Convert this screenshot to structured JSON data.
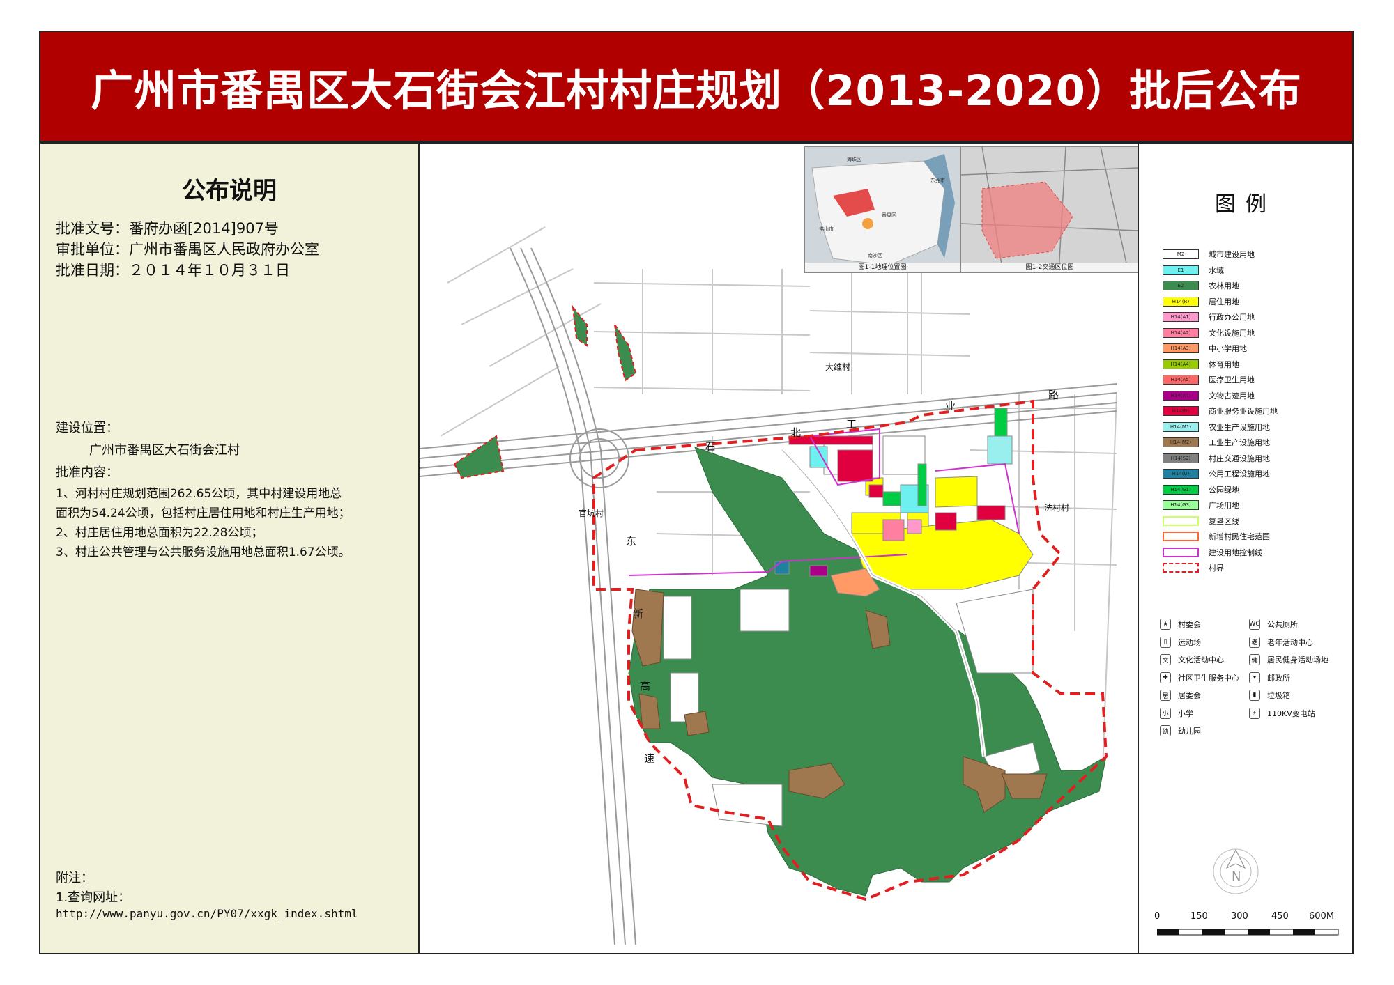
{
  "title": "广州市番禺区大石街会江村村庄规划（2013-2020）批后公布",
  "notice": {
    "heading": "公布说明",
    "approval_no": "批准文号：番府办函[2014]907号",
    "approval_unit": "审批单位：广州市番禺区人民政府办公室",
    "approval_date": "批准日期：２０１４年１０月３１日",
    "location_label": "建设位置：",
    "location_value": "广州市番禺区大石街会江村",
    "content_label": "批准内容：",
    "content_items": [
      "1、河村村庄规划范围262.65公顷，其中村建设用地总",
      "面积为54.24公顷，包括村庄居住用地和村庄生产用地；",
      "2、村庄居住用地总面积为22.28公顷；",
      "3、村庄公共管理与公共服务设施用地总面积1.67公顷。"
    ],
    "note_label": "附注：",
    "note_item": "1.查询网址：",
    "note_url": "http://www.panyu.gov.cn/PY07/xxgk_index.shtml"
  },
  "legend": {
    "title": "图例",
    "items": [
      {
        "code": "M2",
        "label": "城市建设用地",
        "color": "#ffffff"
      },
      {
        "code": "E1",
        "label": "水域",
        "color": "#6ef0f0"
      },
      {
        "code": "E2",
        "label": "农林用地",
        "color": "#3c8c50"
      },
      {
        "code": "H14(R)",
        "label": "居住用地",
        "color": "#ffff00"
      },
      {
        "code": "H14(A1)",
        "label": "行政办公用地",
        "color": "#ff99cc"
      },
      {
        "code": "H14(A2)",
        "label": "文化设施用地",
        "color": "#ff7fa0"
      },
      {
        "code": "H14(A3)",
        "label": "中小学用地",
        "color": "#ff9966"
      },
      {
        "code": "H14(A4)",
        "label": "体育用地",
        "color": "#99cc00"
      },
      {
        "code": "H14(A5)",
        "label": "医疗卫生用地",
        "color": "#ff6666"
      },
      {
        "code": "H14(A7)",
        "label": "文物古迹用地",
        "color": "#aa0088"
      },
      {
        "code": "H14(B)",
        "label": "商业服务业设施用地",
        "color": "#e00040"
      },
      {
        "code": "H14(M1)",
        "label": "农业生产设施用地",
        "color": "#99eeee"
      },
      {
        "code": "H14(M2)",
        "label": "工业生产设施用地",
        "color": "#a07850"
      },
      {
        "code": "H14(S2)",
        "label": "村庄交通设施用地",
        "color": "#808080"
      },
      {
        "code": "H14(U)",
        "label": "公用工程设施用地",
        "color": "#2080a0"
      },
      {
        "code": "H14(G1)",
        "label": "公园绿地",
        "color": "#00cc44"
      },
      {
        "code": "H14(G3)",
        "label": "广场用地",
        "color": "#99ff99"
      },
      {
        "code": "",
        "label": "复垦区线",
        "color": "#ccff66"
      },
      {
        "code": "",
        "label": "新增村民住宅范围",
        "color": "#ff6633"
      },
      {
        "code": "",
        "label": "建设用地控制线",
        "color": "#cc33cc"
      },
      {
        "code": "",
        "label": "村界",
        "color": "#e02020"
      }
    ],
    "symbols_left": [
      {
        "icon": "★",
        "label": "村委会"
      },
      {
        "icon": "▯",
        "label": "运动场"
      },
      {
        "icon": "文",
        "label": "文化活动中心"
      },
      {
        "icon": "✚",
        "label": "社区卫生服务中心"
      },
      {
        "icon": "居",
        "label": "居委会"
      },
      {
        "icon": "小",
        "label": "小学"
      },
      {
        "icon": "幼",
        "label": "幼儿园"
      }
    ],
    "symbols_right": [
      {
        "icon": "WC",
        "label": "公共厕所"
      },
      {
        "icon": "老",
        "label": "老年活动中心"
      },
      {
        "icon": "健",
        "label": "居民健身活动场地"
      },
      {
        "icon": "▾",
        "label": "邮政所"
      },
      {
        "icon": "▮",
        "label": "垃圾箱"
      },
      {
        "icon": "⚡",
        "label": "110KV变电站"
      }
    ],
    "scale_labels": [
      "0",
      "150",
      "300",
      "450",
      "600M"
    ],
    "north": "N"
  },
  "map": {
    "inset1_caption": "图1-1地理位置图",
    "inset2_caption": "图1-2交通区位图",
    "inset1_labels": [
      "海珠区",
      "东莞市",
      "番禺区",
      "佛山市",
      "南沙区"
    ],
    "labels": {
      "dawei": "大维村",
      "guankeng": "官坑村",
      "xicun": "洗村村"
    },
    "road_north": [
      "石",
      "北",
      "工",
      "业",
      "路"
    ],
    "road_east": [
      "东",
      "新",
      "高",
      "速"
    ]
  }
}
